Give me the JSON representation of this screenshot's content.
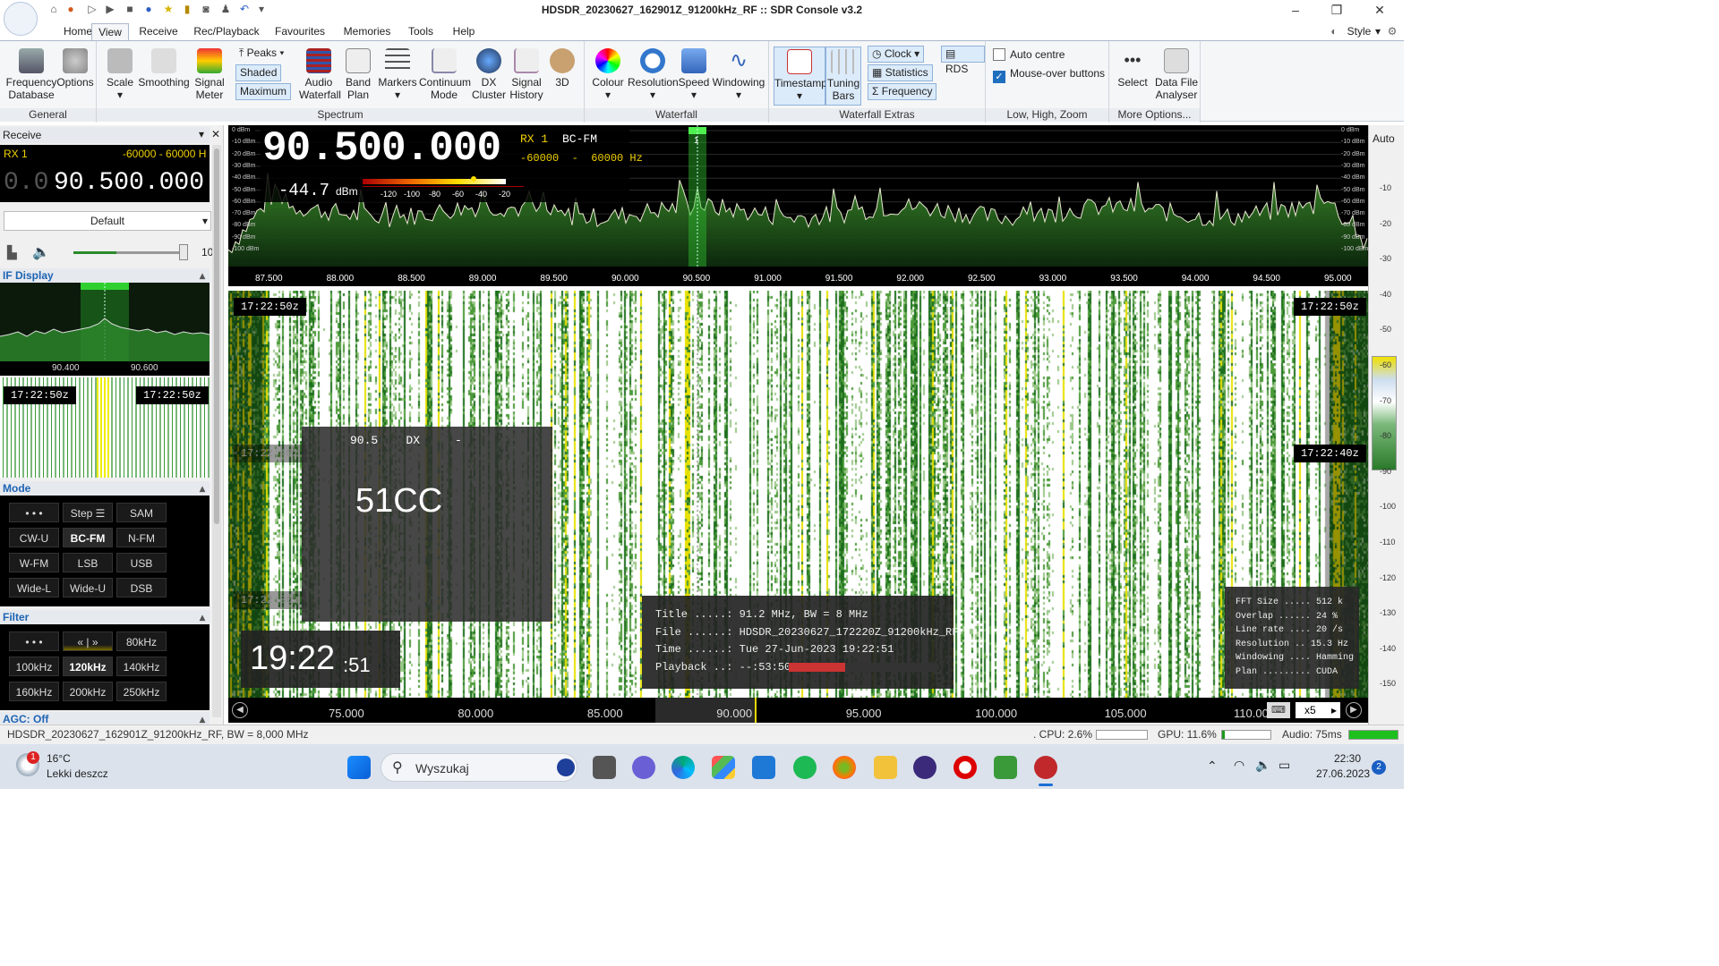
{
  "window": {
    "title": "HDSDR_20230627_162901Z_91200kHz_RF :: SDR Console v3.2"
  },
  "tabs": [
    "Home",
    "View",
    "Receive",
    "Rec/Playback",
    "Favourites",
    "Memories",
    "Tools",
    "Help"
  ],
  "style_menu": "Style",
  "ribbon": {
    "general": {
      "label": "General",
      "buttons": [
        {
          "l1": "Frequency",
          "l2": "Database"
        },
        {
          "l1": "Options",
          "l2": ""
        }
      ]
    },
    "spectrum": {
      "label": "Spectrum",
      "scale": "Scale",
      "smoothing": "Smoothing",
      "signal_l1": "Signal",
      "signal_l2": "Meter",
      "peaks": "Peaks",
      "shaded": "Shaded",
      "maximum": "Maximum",
      "audio_l1": "Audio",
      "audio_l2": "Waterfall",
      "band_l1": "Band",
      "band_l2": "Plan",
      "markers": "Markers",
      "continuum_l1": "Continuum",
      "continuum_l2": "Mode",
      "dx_l1": "DX",
      "dx_l2": "Cluster",
      "sighist_l1": "Signal",
      "sighist_l2": "History",
      "threed": "3D"
    },
    "waterfall": {
      "label": "Waterfall",
      "colour": "Colour",
      "resolution": "Resolution",
      "speed": "Speed",
      "windowing": "Windowing"
    },
    "extras": {
      "label": "Waterfall Extras",
      "timestamp": "Timestamp",
      "tuning_l1": "Tuning",
      "tuning_l2": "Bars",
      "clock": "Clock",
      "statistics": "Statistics",
      "frequency": "Frequency",
      "rds": "RDS"
    },
    "lhz": {
      "label": "Low, High, Zoom",
      "auto_centre": "Auto centre",
      "mouse_over": "Mouse-over buttons"
    },
    "more": {
      "label": "More Options...",
      "select": "Select",
      "dfa_l1": "Data File",
      "dfa_l2": "Analyser"
    }
  },
  "receive": {
    "title": "Receive",
    "rx": "RX 1",
    "range": "-60000 - 60000 H",
    "freq_dim": "0.0",
    "freq": "90.500.000",
    "preset": "Default",
    "volume_num": "10",
    "if_display": "IF Display",
    "if_ticks": [
      "90.400",
      "90.600"
    ],
    "if_ts_left": "17:22:50z",
    "if_ts_right": "17:22:50z",
    "mode_hdr": "Mode",
    "modes": [
      "• • •",
      "Step ☰",
      "SAM",
      "CW-U",
      "BC-FM",
      "N-FM",
      "W-FM",
      "LSB",
      "USB",
      "Wide-L",
      "Wide-U",
      "DSB"
    ],
    "mode_selected": "BC-FM",
    "filter_hdr": "Filter",
    "filters": [
      "• • •",
      "« | »",
      "80kHz",
      "100kHz",
      "120kHz",
      "140kHz",
      "160kHz",
      "200kHz",
      "250kHz"
    ],
    "filter_selected": "120kHz",
    "agc": "AGC: Off"
  },
  "spectrum": {
    "big_freq": "90.500.000",
    "rx": "RX 1",
    "mode": "BC-FM",
    "range": "-60000  -  60000 Hz",
    "level": "-44.7",
    "level_unit": "dBm",
    "meter_ticks": [
      "-120",
      "-100",
      "-80",
      "-60",
      "-40",
      "-20"
    ],
    "db_labels": [
      "0 dBm",
      "-10 dBm",
      "-20 dBm",
      "-30 dBm",
      "-40 dBm",
      "-50 dBm",
      "-60 dBm",
      "-70 dBm",
      "-80 dBm",
      "-90 dBm",
      "-100 dBm"
    ],
    "marker": "1",
    "x_ticks": [
      "87.500",
      "88.000",
      "88.500",
      "89.000",
      "89.500",
      "90.000",
      "90.500",
      "91.000",
      "91.500",
      "92.000",
      "92.500",
      "93.000",
      "93.500",
      "94.000",
      "94.500",
      "95.000"
    ]
  },
  "waterfall": {
    "ts": [
      "17:22:50z",
      "17:22:40z",
      "17:22:30z"
    ],
    "rds_line": "90.5    DX     -",
    "rds_ps": "51CC",
    "clock_hm": "19:22",
    "clock_s": ":51",
    "file_info": [
      "Title .....: 91.2 MHz, BW = 8 MHz",
      "File ......: HDSDR_20230627_172220Z_91200kHz_RF",
      "Time ......: Tue 27-Jun-2023 19:22:51",
      "Playback ..: --:53:50"
    ],
    "playback_progress": 0.38,
    "fft_info": [
      "FFT Size ..... 512 k",
      "Overlap ...... 24 %",
      "Line rate .... 20 /s",
      "Resolution .. 15.3 Hz",
      "Windowing .... Hamming",
      "Plan ......... CUDA"
    ],
    "axis_ticks": [
      "75.000",
      "80.000",
      "85.000",
      "90.000",
      "95.000",
      "100.000",
      "105.000",
      "110.000"
    ],
    "zoom": "x5"
  },
  "right_scale": {
    "auto": "Auto",
    "labels": [
      "-10",
      "-20",
      "-30",
      "-40",
      "-50",
      "-60",
      "-70",
      "-80",
      "-90",
      "-100",
      "-110",
      "-120",
      "-130",
      "-140",
      "-150"
    ]
  },
  "status": {
    "file": "HDSDR_20230627_162901Z_91200kHz_RF, BW = 8,000 MHz",
    "cpu": ". CPU: 2.6%",
    "gpu": "GPU: 11.6%",
    "audio": "Audio: 75ms"
  },
  "taskbar": {
    "temp": "16°C",
    "weather": "Lekki deszcz",
    "search": "Wyszukaj",
    "time": "22:30",
    "date": "27.06.2023",
    "notif": "2",
    "weather_badge": "1"
  }
}
